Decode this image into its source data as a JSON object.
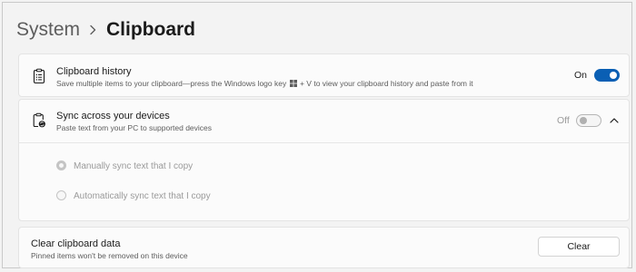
{
  "breadcrumb": {
    "parent": "System",
    "separator": ">",
    "current": "Clipboard"
  },
  "history": {
    "title": "Clipboard history",
    "description_before": "Save multiple items to your clipboard—press the Windows logo key",
    "description_after": "+ V to view your clipboard history and paste from it",
    "state_label": "On",
    "enabled": true,
    "icon": "clipboard-list-icon"
  },
  "sync": {
    "title": "Sync across your devices",
    "description": "Paste text from your PC to supported devices",
    "state_label": "Off",
    "enabled": false,
    "expanded": true,
    "icon": "clipboard-sync-icon",
    "options": [
      {
        "label": "Manually sync text that I copy",
        "selected": true
      },
      {
        "label": "Automatically sync text that I copy",
        "selected": false
      }
    ]
  },
  "clear": {
    "title": "Clear clipboard data",
    "description": "Pinned items won't be removed on this device",
    "button_label": "Clear"
  },
  "colors": {
    "accent": "#0a5fb4",
    "background": "#f3f3f3",
    "card": "#fbfbfb"
  }
}
